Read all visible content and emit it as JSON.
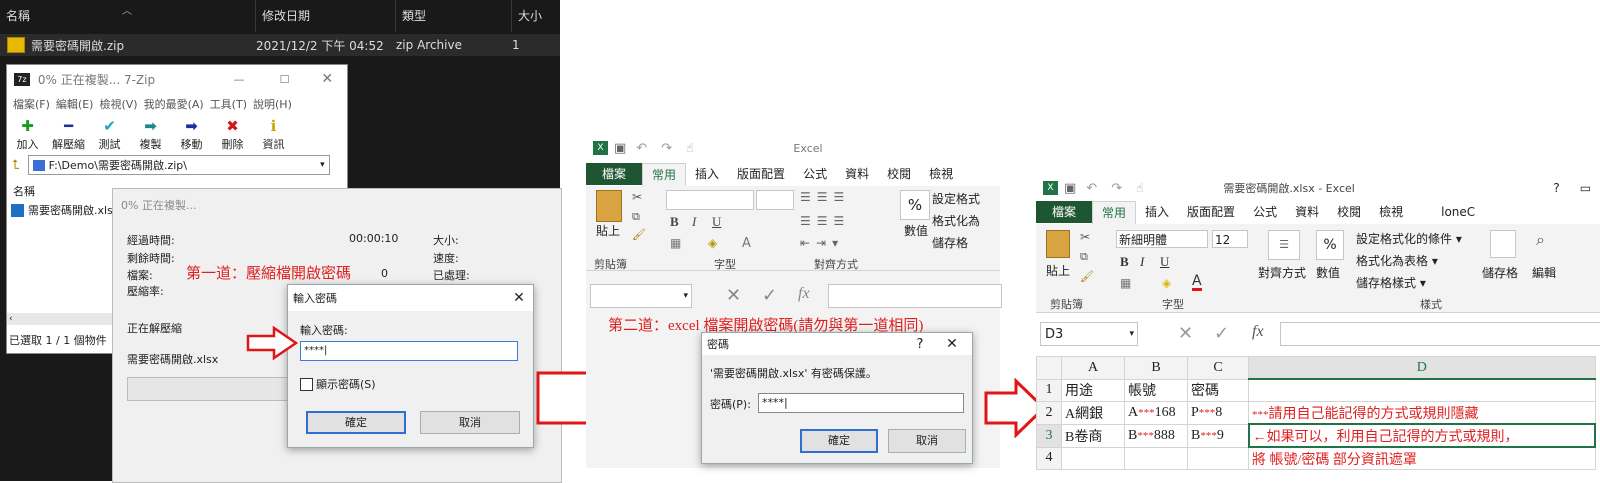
{
  "explorer": {
    "columns": [
      "名稱",
      "修改日期",
      "類型",
      "大小"
    ],
    "file": {
      "name": "需要密碼開啟.zip",
      "date": "2021/12/2 下午 04:52",
      "type": "zip Archive",
      "size_hint": "1"
    }
  },
  "zip": {
    "title": "0% 正在複製... 7-Zip",
    "menu": [
      "檔案(F)",
      "編輯(E)",
      "檢視(V)",
      "我的最愛(A)",
      "工具(T)",
      "說明(H)"
    ],
    "toolbar": [
      "加入",
      "解壓縮",
      "測試",
      "複製",
      "移動",
      "刪除",
      "資訊"
    ],
    "path": "F:\\Demo\\需要密碼開啟.zip\\",
    "list_header": "名稱",
    "list_file": "需要密碼開啟.xlsx",
    "status": "已選取 1 / 1 個物件"
  },
  "copy": {
    "title": "0% 正在複製...",
    "elapsed_label": "經過時間:",
    "elapsed_value": "00:00:10",
    "remaining_label": "剩餘時間:",
    "files_label": "檔案:",
    "files_value": "0",
    "ratio_label": "壓縮率:",
    "size_label": "大小:",
    "speed_label": "速度:",
    "processed_label": "已處理:",
    "extracting": "正在解壓縮",
    "current_file": "需要密碼開啟.xlsx"
  },
  "pwd_dialog": {
    "title": "輸入密碼",
    "label": "輸入密碼:",
    "value": "****|",
    "show_label": "顯示密碼(S)",
    "ok": "確定",
    "cancel": "取消"
  },
  "annotation1": "第一道：壓縮檔開啟密碼",
  "annotation2": "第二道：excel 檔案開啟密碼(請勿與第一道相同)",
  "excel1": {
    "title": "Excel",
    "tabs": [
      "檔案",
      "常用",
      "插入",
      "版面配置",
      "公式",
      "資料",
      "校閱",
      "檢視"
    ],
    "groups": [
      "剪貼簿",
      "字型",
      "對齊方式",
      "數值"
    ],
    "paste": "貼上",
    "styles": [
      "設定格式",
      "格式化為",
      "儲存格"
    ],
    "number_label": "數值"
  },
  "xpwd": {
    "title": "密碼",
    "help": "?",
    "message": "'需要密碼開啟.xlsx' 有密碼保護。",
    "label": "密碼(P):",
    "value": "****|",
    "ok": "確定",
    "cancel": "取消"
  },
  "excel2": {
    "title": "需要密碼開啟.xlsx - Excel",
    "help": "?",
    "tabs": [
      "檔案",
      "常用",
      "插入",
      "版面配置",
      "公式",
      "資料",
      "校閱",
      "檢視",
      "loneC"
    ],
    "font": "新細明體",
    "size": "12",
    "groups": [
      "剪貼簿",
      "字型",
      "對齊方式",
      "數值",
      "樣式",
      "儲存格",
      "編輯"
    ],
    "styles": [
      "設定格式化的條件 ▾",
      "格式化為表格 ▾",
      "儲存格樣式 ▾"
    ],
    "namebox": "D3",
    "cols": [
      "A",
      "B",
      "C",
      "D"
    ],
    "rows": [
      {
        "n": "1",
        "a": "用途",
        "b": "帳號",
        "c": "密碼",
        "d": ""
      },
      {
        "n": "2",
        "a": "A網銀",
        "b_pre": "A",
        "b_mask": "***",
        "b_post": "168",
        "c_pre": "P",
        "c_mask": "***",
        "c_post": "8",
        "d_mask": "***",
        "d_text": "請用自己能記得的方式或規則隱藏"
      },
      {
        "n": "3",
        "a": "B卷商",
        "b_pre": "B",
        "b_mask": "***",
        "b_post": "888",
        "c_pre": "B",
        "c_mask": "***",
        "c_post": "9",
        "d_text": "←如果可以，利用自己記得的方式或規則，"
      },
      {
        "n": "4",
        "a": "",
        "d_text": "將 帳號/密碼 部分資訊遮罩"
      }
    ]
  },
  "colors": {
    "excel_green": "#217346",
    "arrow_red": "#e01515",
    "anno_red": "#e02020"
  }
}
